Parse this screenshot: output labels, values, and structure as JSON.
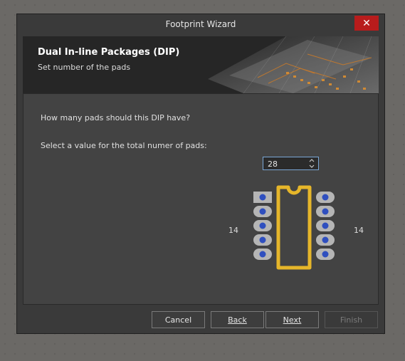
{
  "window": {
    "title": "Footprint Wizard",
    "close_symbol": "✕"
  },
  "banner": {
    "title": "Dual In-line Packages (DIP)",
    "subtitle": "Set number of the pads"
  },
  "content": {
    "question": "How many pads should this DIP have?",
    "prompt": "Select a value for the total numer of pads:",
    "pad_count_value": "28",
    "left_pad_count": "14",
    "right_pad_count": "14"
  },
  "buttons": {
    "cancel": "Cancel",
    "back": "Back",
    "next": "Next",
    "finish": "Finish"
  },
  "colors": {
    "close_red": "#b81c1c",
    "pad_blue": "#2f4fbf",
    "pad_grey": "#b5b5b5",
    "outline_yellow": "#e6b62a"
  },
  "icons": {
    "close": "close-icon",
    "spin_up": "chevron-up-icon",
    "spin_down": "chevron-down-icon"
  }
}
